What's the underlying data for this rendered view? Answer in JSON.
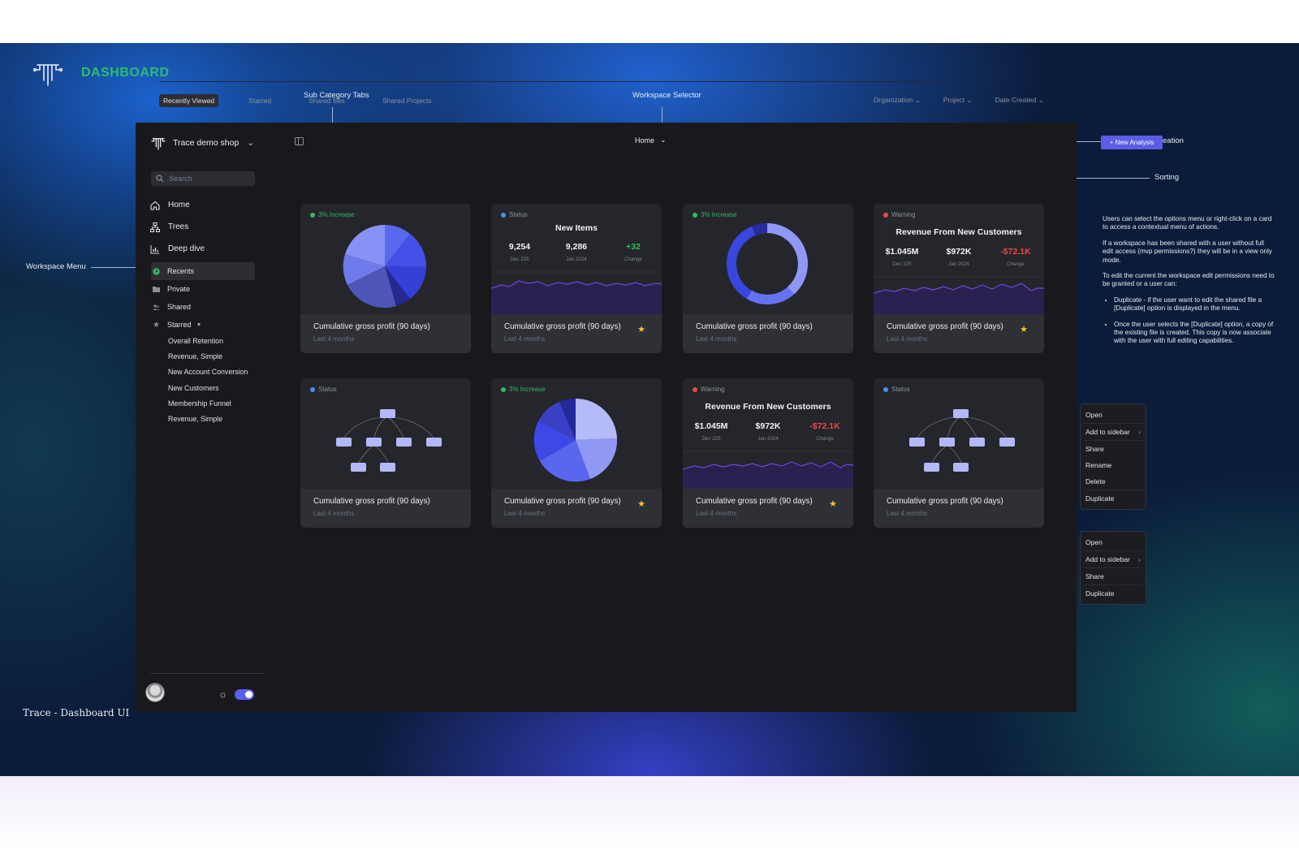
{
  "brand": {
    "title": "DASHBOARD"
  },
  "annotations": {
    "sub_category_tabs": "Sub Category Tabs",
    "workspace_selector": "Workspace Selector",
    "creation": "Creation",
    "sorting": "Sorting",
    "workspace_menu": "Workspace Menu"
  },
  "notes": {
    "p1": "Users can select the options menu or right-click on a card to access a contextual menu of actions.",
    "p2": "If a workspace has been shared with a user without full edit access (mvp permissions?) they will be in a view only mode.",
    "p3": "To edit the current the workspace edit permissions need to be granted or a user can:",
    "b1": "Duplicate - if the user want to edit the shared file a [Duplicate] option is displayed in the menu.",
    "b2": "Once the user selects the [Duplicate] option, a copy of the existing file is created. This copy is now associate with the user with full editing capabilities."
  },
  "caption": "Trace - Dashboard UI",
  "sidebar": {
    "workspace": "Trace demo shop",
    "search_placeholder": "Search",
    "nav": [
      {
        "label": "Home",
        "icon": "home-icon"
      },
      {
        "label": "Trees",
        "icon": "tree-icon"
      },
      {
        "label": "Deep dive",
        "icon": "bar-chart-icon"
      }
    ],
    "sections": [
      {
        "label": "Recents",
        "icon": "clock-icon"
      },
      {
        "label": "Private",
        "icon": "folder-icon"
      },
      {
        "label": "Shared",
        "icon": "users-icon"
      }
    ],
    "starred_label": "Starred",
    "starred": [
      "Overall Retention",
      "Revenue, Simple",
      "New Account Conversion",
      "New Customers",
      "Membership Funnel",
      "Revenue, Simple"
    ]
  },
  "header": {
    "workspace_selector": "Home",
    "new_button": "+ New Analysis",
    "tabs": [
      "Recently Viewed",
      "Starred",
      "Shared files",
      "Shared Projects"
    ],
    "sorts": [
      "Organization",
      "Project",
      "Date Created"
    ]
  },
  "colors": {
    "accent": "#5a5de6",
    "increase": "#36b56a",
    "status": "#4a90e8",
    "warning": "#e84a4a",
    "star": "#f3c231"
  },
  "cards": [
    {
      "tag": "3% Increase",
      "title": "Cumulative gross profit (90 days)",
      "sub": "Last 4 months"
    },
    {
      "tag": "Status",
      "headline": "New Items",
      "stats": [
        {
          "v": "9,254",
          "l": "Dec 225"
        },
        {
          "v": "9,286",
          "l": "Jan 2024"
        },
        {
          "v": "+32",
          "l": "Change"
        }
      ],
      "title": "Cumulative gross profit (90 days)",
      "sub": "Last 4 months",
      "starred": true
    },
    {
      "tag": "3% Increase",
      "title": "Cumulative gross profit (90 days)",
      "sub": "Last 4 months"
    },
    {
      "tag": "Warning",
      "headline": "Revenue From New Customers",
      "stats": [
        {
          "v": "$1.045M",
          "l": "Dec 225"
        },
        {
          "v": "$972K",
          "l": "Jan 2024"
        },
        {
          "v": "-$72.1K",
          "l": "Change"
        }
      ],
      "title": "Cumulative gross profit (90 days)",
      "sub": "Last 4 months",
      "starred": true
    },
    {
      "tag": "Status",
      "title": "Cumulative gross profit (90 days)",
      "sub": "Last 4 months"
    },
    {
      "tag": "3% Increase",
      "title": "Cumulative gross profit (90 days)",
      "sub": "Last 4 months",
      "starred": true
    },
    {
      "tag": "Warning",
      "headline": "Revenue From New Customers",
      "stats": [
        {
          "v": "$1.045M",
          "l": "Dec 225"
        },
        {
          "v": "$972K",
          "l": "Jan 2024"
        },
        {
          "v": "-$72.1K",
          "l": "Change"
        }
      ],
      "title": "Cumulative gross profit (90 days)",
      "sub": "Last 4 months",
      "starred": true
    },
    {
      "tag": "Status",
      "title": "Cumulative gross profit (90 days)",
      "sub": "Last 4 months"
    }
  ],
  "menus": [
    [
      "Open",
      "Add to sidebar",
      "Share",
      "Rename",
      "Delete",
      "Duplicate"
    ],
    [
      "Open",
      "Add to sidebar",
      "Share",
      "Duplicate"
    ]
  ]
}
